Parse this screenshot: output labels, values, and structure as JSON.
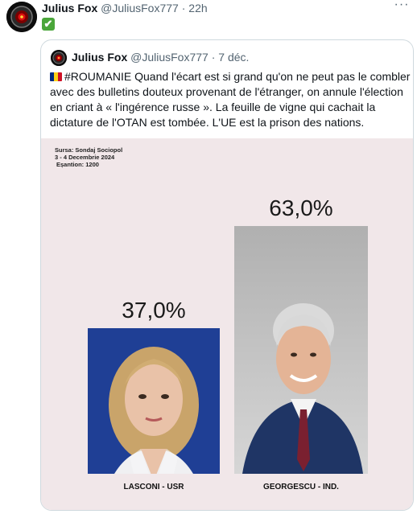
{
  "tweet": {
    "author_name": "Julius Fox",
    "author_handle": "@JuliusFox777",
    "separator": "·",
    "time": "22h",
    "more_label": "···",
    "body_emoji": "✔"
  },
  "quoted": {
    "author_name": "Julius Fox",
    "author_handle": "@JuliusFox777",
    "separator": "·",
    "time": "7 déc.",
    "text": "#ROUMANIE Quand l'écart est si grand qu'on ne peut pas le combler avec des bulletins douteux provenant de l'étranger, on annule l'élection en criant à « l'ingérence russe ». La feuille de vigne qui cachait la dictature de l'OTAN est tombée. L'UE est la prison des nations."
  },
  "poll_image": {
    "source_lines": [
      "Sursa: Sondaj Sociopol",
      "3 - 4 Decembrie 2024",
      "Eșantion: 1200"
    ],
    "colors": {
      "background": "#f1e7e9",
      "left_bar": "#1f3f95",
      "right_bar": "#c6c6c6"
    }
  },
  "chart_data": {
    "type": "bar",
    "categories": [
      "LASCONI - USR",
      "GEORGESCU - IND."
    ],
    "values": [
      37.0,
      63.0
    ],
    "value_labels": [
      "37,0%",
      "63,0%"
    ],
    "ylim": [
      0,
      63
    ]
  }
}
